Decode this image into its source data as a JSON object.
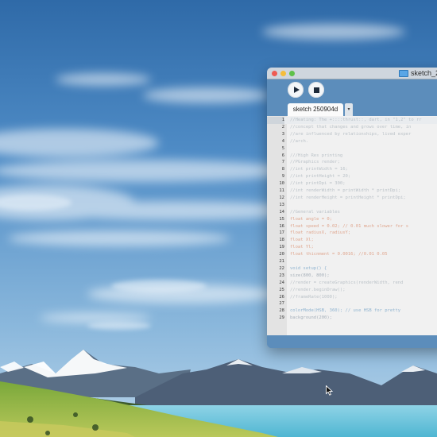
{
  "window": {
    "title": "sketch_2",
    "tab_label": "sketch 250904d",
    "tab_menu_glyph": "▾"
  },
  "toolbar": {
    "run_icon": "play-icon",
    "stop_icon": "stop-icon"
  },
  "editor": {
    "active_line": 1,
    "lines": [
      {
        "n": "1",
        "t": "//Heating: The +::::thrust::, dart, in \"1,2\" to rr",
        "s": "comment"
      },
      {
        "n": "2",
        "t": "//concept that changes and grows over time, in",
        "s": "comment"
      },
      {
        "n": "3",
        "t": "//are influenced by relationships, lived exper",
        "s": "comment"
      },
      {
        "n": "4",
        "t": "//arch.",
        "s": "comment"
      },
      {
        "n": "5",
        "t": "",
        "s": "plain"
      },
      {
        "n": "6",
        "t": "///High Res printing",
        "s": "comment"
      },
      {
        "n": "7",
        "t": "//PGraphics render;",
        "s": "comment"
      },
      {
        "n": "8",
        "t": "//int printWidth = 16;",
        "s": "comment"
      },
      {
        "n": "9",
        "t": "//int printHeight = 20;",
        "s": "comment"
      },
      {
        "n": "10",
        "t": "//int printDpi = 300;",
        "s": "comment"
      },
      {
        "n": "11",
        "t": "//int renderWidth = printWidth * printDpi;",
        "s": "comment"
      },
      {
        "n": "12",
        "t": "//int renderHeight = printHeight * printDpi;",
        "s": "comment"
      },
      {
        "n": "13",
        "t": "",
        "s": "plain"
      },
      {
        "n": "14",
        "t": "//General variables",
        "s": "comment"
      },
      {
        "n": "15",
        "t": "float angle = 0;",
        "s": "kw"
      },
      {
        "n": "16",
        "t": "float speed = 0.02; // 0.01 much slower for s",
        "s": "kw"
      },
      {
        "n": "17",
        "t": "float radiusX, radiusY;",
        "s": "kw"
      },
      {
        "n": "18",
        "t": "float Xl;",
        "s": "kw"
      },
      {
        "n": "19",
        "t": "float Yl;",
        "s": "kw"
      },
      {
        "n": "20",
        "t": "float thicnment = 0.0016; //0.01 0.05",
        "s": "kw"
      },
      {
        "n": "21",
        "t": "",
        "s": "plain"
      },
      {
        "n": "22",
        "t": "void setup() {",
        "s": "blue"
      },
      {
        "n": "23",
        "t": "  size(800, 800);",
        "s": "plain"
      },
      {
        "n": "24",
        "t": "  //render = createGraphics(renderWidth, rend",
        "s": "comment"
      },
      {
        "n": "25",
        "t": "  //render.beginDraw();",
        "s": "comment"
      },
      {
        "n": "26",
        "t": "  //frameRate(1000);",
        "s": "comment"
      },
      {
        "n": "27",
        "t": "",
        "s": "plain"
      },
      {
        "n": "28",
        "t": "  colorMode(HSB, 360); // use HSB for pretty",
        "s": "blue"
      },
      {
        "n": "29",
        "t": "  background(200);",
        "s": "plain"
      }
    ]
  },
  "colors": {
    "window_frame": "#5c8dbb",
    "editor_bg": "#f1f1f1",
    "gutter_bg": "#e3e3e3",
    "close": "#ee5b53",
    "minimize": "#f5bd3b",
    "maximize": "#5ec14a"
  }
}
